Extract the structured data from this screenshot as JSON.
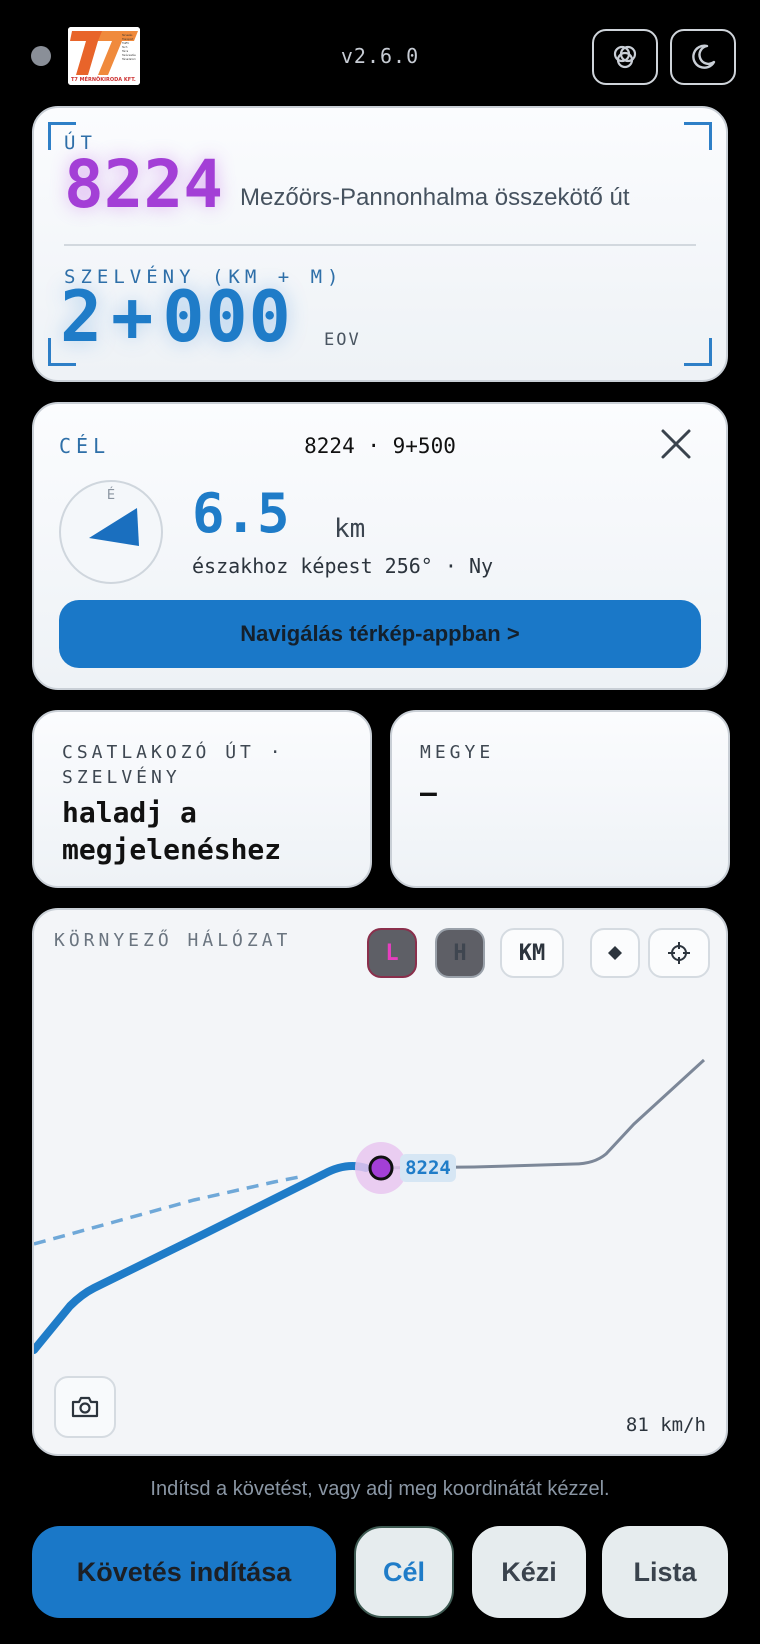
{
  "header": {
    "version": "v2.6.0",
    "logo_caption": "T7 MÉRNÖKIRODA KFT.",
    "logo_lines": [
      "Tervezés",
      "Transport",
      "Traffic",
      "Tech",
      "Tárca",
      "Tanácsadás",
      "Társadalom"
    ],
    "theme_button_icon": "overlap-circles-icon",
    "dark_mode_icon": "moon-icon"
  },
  "road": {
    "label": "ÚT",
    "number": "8224",
    "name": "Mezőörs-Pannonhalma összekötő út",
    "chainage_label": "SZELVÉNY (KM + M)",
    "chainage_km": "2",
    "chainage_sep": "+",
    "chainage_m": "000",
    "crs": "EOV"
  },
  "target": {
    "label": "CÉL",
    "name": "8224 · 9+500",
    "distance": "6.5",
    "distance_unit": "km",
    "bearing_text": "északhoz képest 256° · Ny",
    "bearing_deg": 256,
    "compass_north": "É",
    "nav_button": "Navigálás térkép-appban >"
  },
  "junction": {
    "label": "CSATLAKOZÓ ÚT · SZELVÉNY",
    "value": "haladj a megjelenéshez"
  },
  "county": {
    "label": "MEGYE",
    "value": "–"
  },
  "map": {
    "title": "KÖRNYEZŐ HÁLÓZAT",
    "btn_l": "L",
    "btn_h": "H",
    "btn_km": "KM",
    "position_label": "8224",
    "speed": "81 km/h",
    "colors": {
      "route": "#1f7cc8",
      "other": "#7c8798",
      "position": "#a33fd6"
    }
  },
  "footer": {
    "hint": "Indítsd a követést, vagy adj meg koordinátát kézzel.",
    "start_tracking": "Követés indítása",
    "target": "Cél",
    "manual": "Kézi",
    "list": "Lista"
  }
}
